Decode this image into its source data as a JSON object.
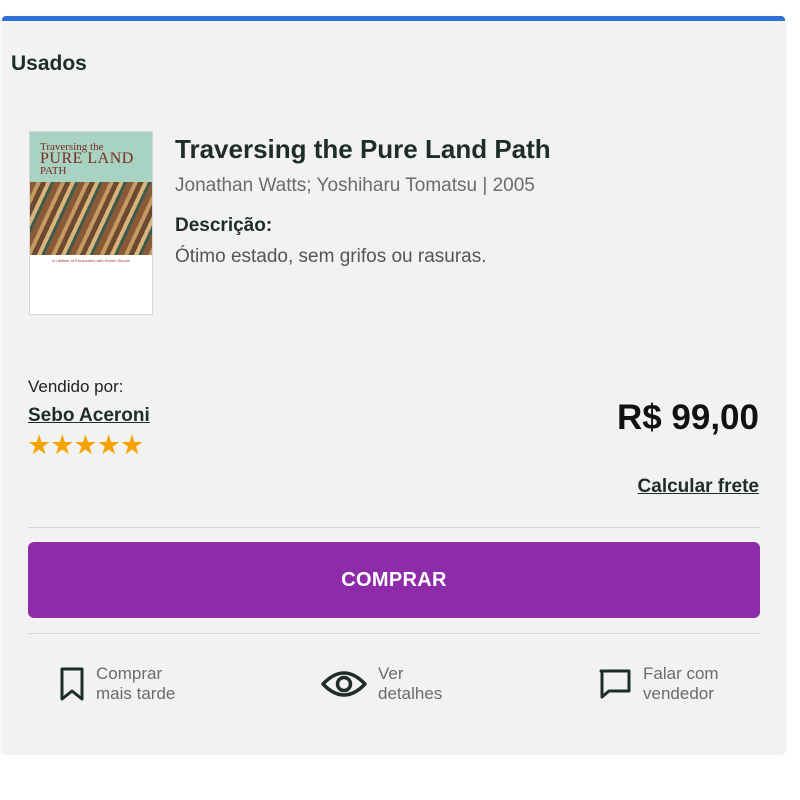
{
  "section": {
    "title": "Usados"
  },
  "book": {
    "title": "Traversing the Pure Land Path",
    "authors_year": "Jonathan Watts; Yoshiharu Tomatsu | 2005",
    "description_label": "Descrição:",
    "description": "Ótimo estado, sem grifos ou rasuras.",
    "cover": {
      "line1": "Traversing the",
      "line2": "PURE LAND",
      "line3": "PATH",
      "subtitle": "A Lifetime of Encounters with Honen Shonin"
    }
  },
  "seller": {
    "label": "Vendido por:",
    "name": "Sebo Aceroni",
    "rating": 5,
    "stars_text": "★★★★★"
  },
  "price": "R$ 99,00",
  "freight_link": "Calcular frete",
  "buy_button": "COMPRAR",
  "actions": [
    {
      "line1": "Comprar",
      "line2": "mais tarde",
      "icon": "bookmark-icon"
    },
    {
      "line1": "Ver",
      "line2": "detalhes",
      "icon": "eye-icon"
    },
    {
      "line1": "Falar com",
      "line2": "vendedor",
      "icon": "chat-icon"
    }
  ],
  "colors": {
    "accent_bar": "#2f6fd6",
    "buy_button": "#8e2ba8",
    "stars": "#f4a300",
    "heading": "#1f2d2a"
  }
}
